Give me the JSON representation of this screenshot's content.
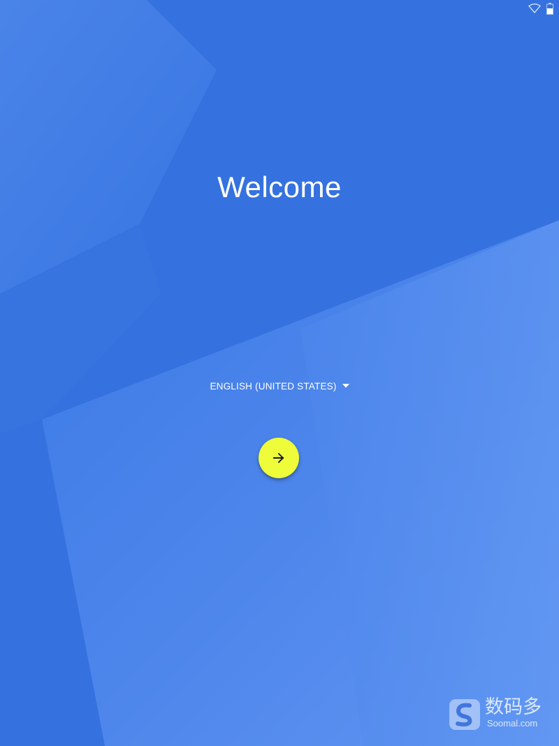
{
  "status_bar": {
    "icons": [
      "wifi-icon",
      "battery-icon"
    ]
  },
  "welcome": {
    "title": "Welcome"
  },
  "language": {
    "selected": "ENGLISH (UNITED STATES)",
    "icon": "dropdown-triangle-icon"
  },
  "next_button": {
    "icon": "arrow-right-icon",
    "color": "#eefc3a"
  },
  "watermark": {
    "cn_text": "数码多",
    "en_text": "Soomal.com"
  },
  "colors": {
    "background_dark": "#3370e0",
    "background_light": "#5a90f0",
    "accent_fab": "#eefc3a",
    "text": "#ffffff"
  }
}
